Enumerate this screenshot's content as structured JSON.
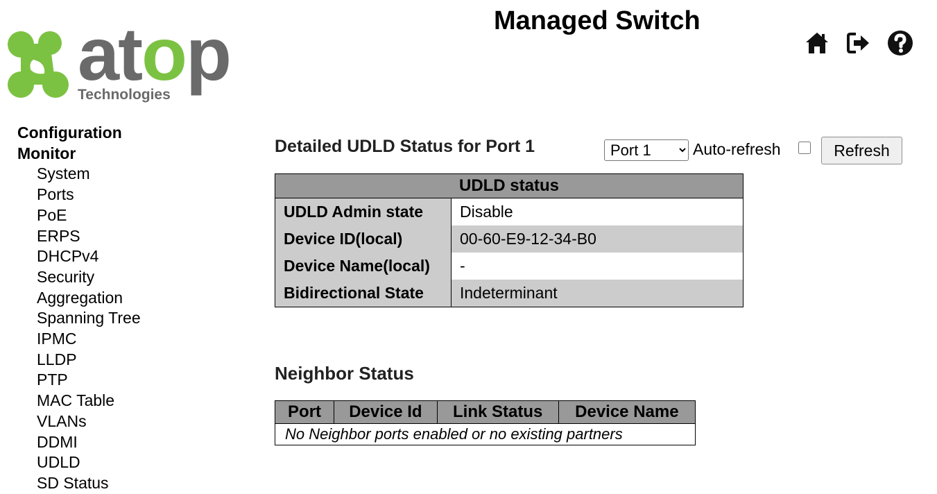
{
  "app_title": "Managed Switch",
  "logo": {
    "letters_a": "a",
    "letters_t": "t",
    "letters_o": "o",
    "letters_p": "p",
    "subtitle": "Technologies"
  },
  "header_icons": [
    "home-icon",
    "logout-icon",
    "help-icon"
  ],
  "sidebar": {
    "configuration": "Configuration",
    "monitor": "Monitor",
    "items": [
      "System",
      "Ports",
      "PoE",
      "ERPS",
      "DHCPv4",
      "Security",
      "Aggregation",
      "Spanning Tree",
      "IPMC",
      "LLDP",
      "PTP",
      "MAC Table",
      "VLANs",
      "DDMI",
      "UDLD",
      "SD Status"
    ]
  },
  "main": {
    "title": "Detailed UDLD Status for Port 1",
    "port_select": {
      "value": "Port 1",
      "options": [
        "Port 1"
      ]
    },
    "auto_refresh_label": "Auto-refresh",
    "auto_refresh_checked": false,
    "refresh_label": "Refresh",
    "udld_table": {
      "header": "UDLD status",
      "rows": [
        {
          "key": "UDLD Admin state",
          "value": "Disable"
        },
        {
          "key": "Device ID(local)",
          "value": "00-60-E9-12-34-B0"
        },
        {
          "key": "Device Name(local)",
          "value": "-"
        },
        {
          "key": "Bidirectional State",
          "value": "Indeterminant"
        }
      ]
    },
    "neighbor_title": "Neighbor Status",
    "neighbor_table": {
      "columns": [
        "Port",
        "Device Id",
        "Link Status",
        "Device Name"
      ],
      "empty_message": "No Neighbor ports enabled or no existing partners"
    }
  },
  "colors": {
    "logo_green": "#7cc242",
    "logo_gray": "#6a6a6a",
    "table_header": "#999999",
    "table_stripe": "#cccccc"
  }
}
